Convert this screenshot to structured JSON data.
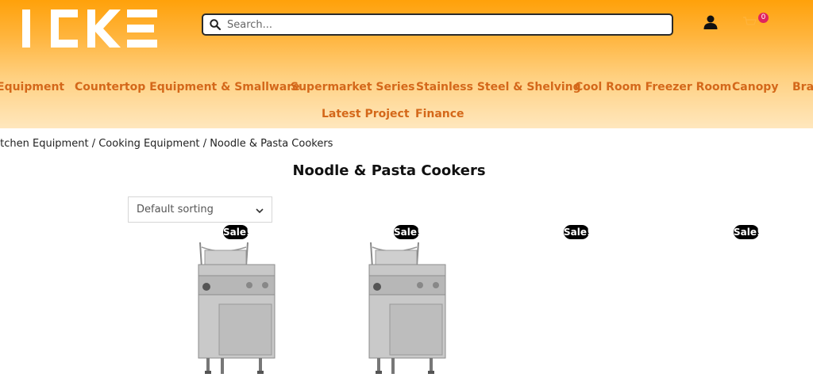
{
  "header": {
    "logo_text": "ICKE",
    "search": {
      "placeholder": "Search..."
    },
    "cart_count": "0",
    "accent": "#d4681a",
    "gradient_top": "#ffa10a",
    "gradient_bottom": "#ffe7bd"
  },
  "nav": {
    "row1": [
      {
        "label": "Equipment"
      },
      {
        "label": "Countertop Equipment & Smallware"
      },
      {
        "label": "Supermarket Series"
      },
      {
        "label": "Stainless Steel & Shelving"
      },
      {
        "label": "Cool Room Freezer Room"
      },
      {
        "label": "Canopy"
      },
      {
        "label": "Bra"
      }
    ],
    "row2": [
      {
        "label": "Latest Project"
      },
      {
        "label": "Finance"
      }
    ]
  },
  "breadcrumb": {
    "items": [
      "Kitchen Equipment",
      "Cooking Equipment",
      "Noodle & Pasta Cookers"
    ],
    "separator": "/"
  },
  "page": {
    "title": "Noodle & Pasta Cookers",
    "sorting_selected": "Default sorting"
  },
  "products": [
    {
      "badge": "Sale!"
    },
    {
      "badge": "Sale!"
    },
    {
      "badge": "Sale!"
    },
    {
      "badge": "Sale!"
    }
  ],
  "icons": {
    "search": "search-icon",
    "user": "user-icon",
    "cart": "cart-icon",
    "sort": "chevron-down-icon"
  }
}
